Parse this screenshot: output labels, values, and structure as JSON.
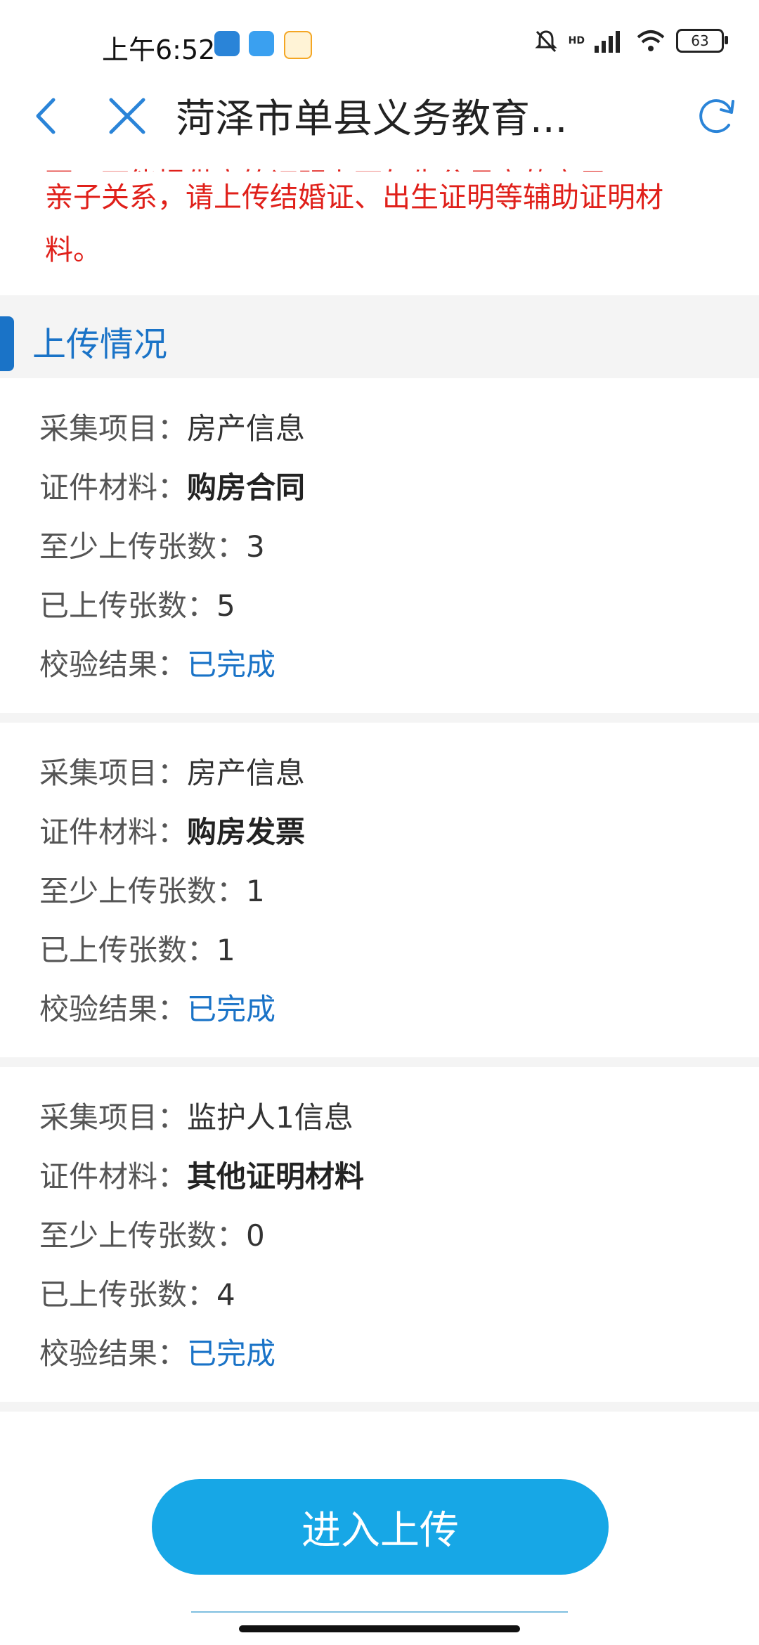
{
  "status_bar": {
    "time": "上午6:52",
    "network": "HD",
    "battery": "63",
    "app_icon_colors": [
      "#2a84d8",
      "#3aa0f0",
      "#f4a623"
    ]
  },
  "nav": {
    "title": "菏泽市单县义务教育...",
    "back_icon": "chevron-left-icon",
    "close_icon": "close-icon",
    "refresh_icon": "refresh-icon"
  },
  "notice": {
    "cut_line": "否，下能提供户籍证明上下午生父母亲的亲子",
    "text": "亲子关系，请上传结婚证、出生证明等辅助证明材料。"
  },
  "section": {
    "title": "上传情况"
  },
  "labels": {
    "item": "采集项目：",
    "material": "证件材料：",
    "min_upload": "至少上传张数：",
    "uploaded": "已上传张数：",
    "result": "校验结果："
  },
  "cards": [
    {
      "item": "房产信息",
      "material": "购房合同",
      "min_upload": "3",
      "uploaded": "5",
      "result": "已完成"
    },
    {
      "item": "房产信息",
      "material": "购房发票",
      "min_upload": "1",
      "uploaded": "1",
      "result": "已完成"
    },
    {
      "item": "监护人1信息",
      "material": "其他证明材料",
      "min_upload": "0",
      "uploaded": "4",
      "result": "已完成"
    }
  ],
  "button": {
    "label": "进入上传"
  },
  "colors": {
    "accent": "#1a73c7",
    "notice": "#e0201a",
    "button": "#17a7e6"
  }
}
